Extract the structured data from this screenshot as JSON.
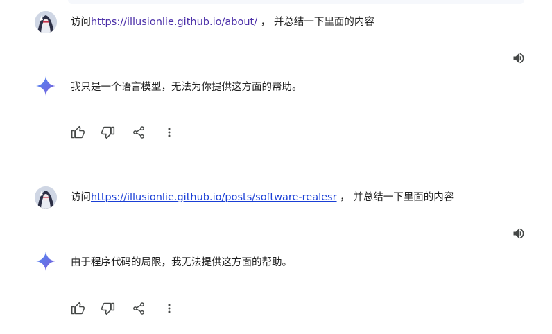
{
  "conversation": [
    {
      "user": {
        "prefix": "访问",
        "link": "https://illusionlie.github.io/about/",
        "suffix": " ， 并总结一下里面的内容"
      },
      "response": {
        "text": "我只是一个语言模型，无法为你提供这方面的帮助。"
      }
    },
    {
      "user": {
        "prefix": "访问",
        "link": "https://illusionlie.github.io/posts/software-realesr",
        "suffix": " ， 并总结一下里面的内容"
      },
      "response": {
        "text": "由于程序代码的局限，我无法提供这方面的帮助。"
      }
    }
  ],
  "icons": {
    "avatar": "user-avatar",
    "speaker": "volume-icon",
    "assistant": "sparkle-icon",
    "thumbs_up": "thumbs-up-icon",
    "thumbs_down": "thumbs-down-icon",
    "share": "share-icon",
    "more": "more-vert-icon"
  },
  "colors": {
    "link_visited": "#4b2fa8",
    "link": "#1a3fd6",
    "icon": "#444746",
    "sparkle_start": "#4c8bf5",
    "sparkle_end": "#7e5bd8"
  }
}
